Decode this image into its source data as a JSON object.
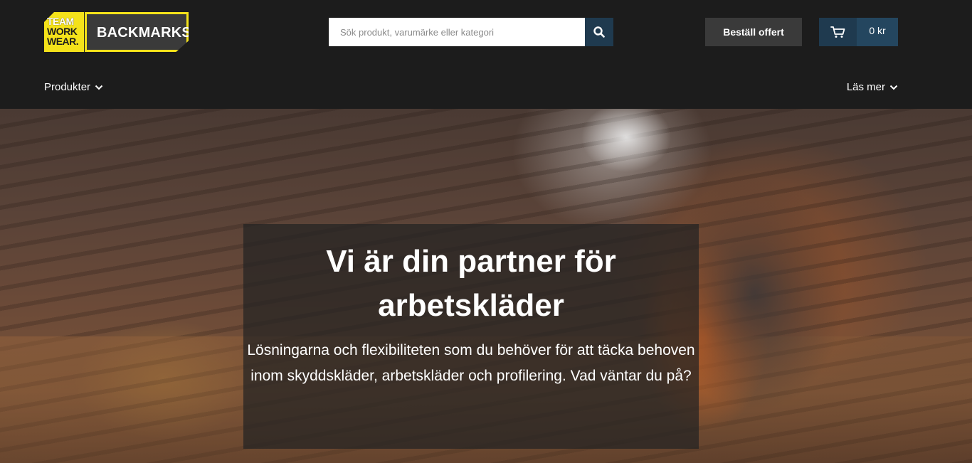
{
  "logo": {
    "team_line1": "TEAM",
    "team_line2": "WORK",
    "team_line3": "WEAR.",
    "brand": "BACKMARKS"
  },
  "search": {
    "placeholder": "Sök produkt, varumärke eller kategori",
    "icon": "search-icon"
  },
  "header": {
    "quote_button": "Beställ offert",
    "cart_total": "0 kr",
    "cart_icon": "cart-icon"
  },
  "nav": {
    "products": "Produkter",
    "read_more": "Läs mer"
  },
  "hero": {
    "title": "Vi är din partner för arbetskläder",
    "text": "Lösningarna och flexibiliteten som du behöver för att täcka behoven inom skyddskläder, arbetskläder och profilering. Vad väntar du på?"
  },
  "colors": {
    "header_bg": "#1c1c1c",
    "accent_yellow": "#f4e21a",
    "button_blue": "#1f3a4f",
    "button_gray": "#3a3a3a"
  }
}
